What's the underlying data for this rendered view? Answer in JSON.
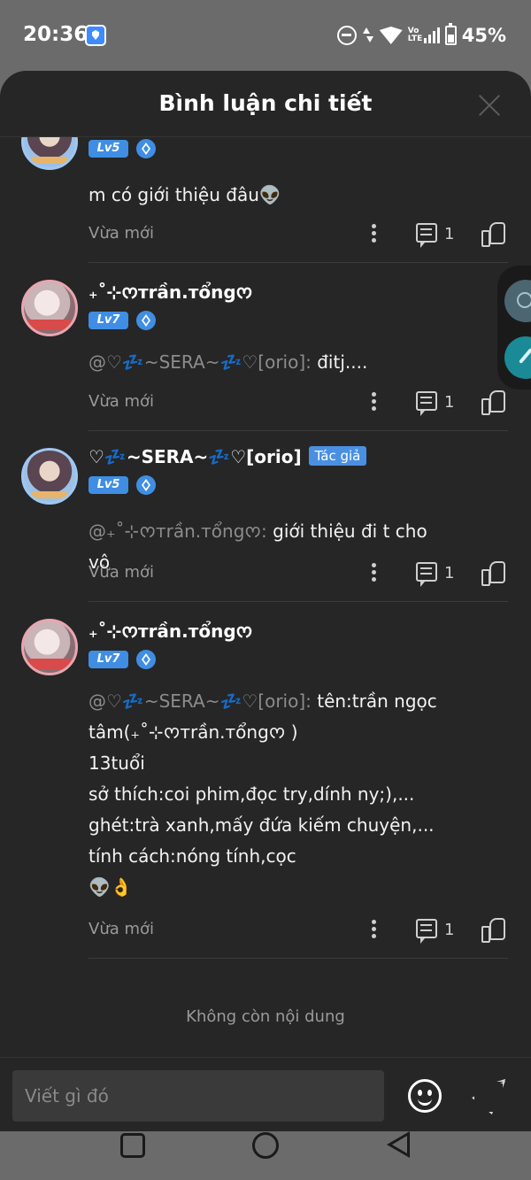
{
  "status_bar": {
    "time": "20:36",
    "volte": "Vo LTE",
    "battery_pct": "45%"
  },
  "sheet": {
    "title": "Bình luận chi tiết"
  },
  "comments": [
    {
      "level": "Lv5",
      "text": "m có giới thiệu đâu👽",
      "time": "Vừa mới",
      "reply_count": "1"
    },
    {
      "username": "₊˚⊹ᰔтrần.тổngᰔ",
      "level": "Lv7",
      "mention": "@♡💤~SERA~💤♡[orio]:",
      "text": " đitj....",
      "time": "Vừa mới",
      "reply_count": "1"
    },
    {
      "username": "♡💤~SERA~💤♡[orio]",
      "author_badge": "Tác giả",
      "level": "Lv5",
      "mention": "@₊˚⊹ᰔтrần.тổngᰔ:",
      "text": " giới thiệu đi t cho vô",
      "time": "Vừa mới",
      "reply_count": "1"
    },
    {
      "username": "₊˚⊹ᰔтrần.тổngᰔ",
      "level": "Lv7",
      "mention": "@♡💤~SERA~💤♡[orio]:",
      "text": " tên:trần ngọc tâm(₊˚⊹ᰔтrần.тổngᰔ )\n13tuổi\nsở thích:coi phim,đọc try,dính ny;),...\nghét:trà xanh,mấy đứa kiếm chuyện,...\ntính cách:nóng tính,cọc\n👽👌",
      "time": "Vừa mới",
      "reply_count": "1"
    }
  ],
  "end_text": "Không còn nội dung",
  "input": {
    "placeholder": "Viết gì đó"
  },
  "colors": {
    "background": "#262626",
    "accent": "#3f8ee3",
    "muted_text": "#9a9a9a",
    "fab": "#1b8a97"
  },
  "icons": [
    "shield-icon",
    "dnd-icon",
    "wifi-icon",
    "signal-icon",
    "battery-icon",
    "close-icon",
    "gem-icon",
    "more-icon",
    "reply-icon",
    "like-icon",
    "emoji-icon",
    "send-icon"
  ]
}
